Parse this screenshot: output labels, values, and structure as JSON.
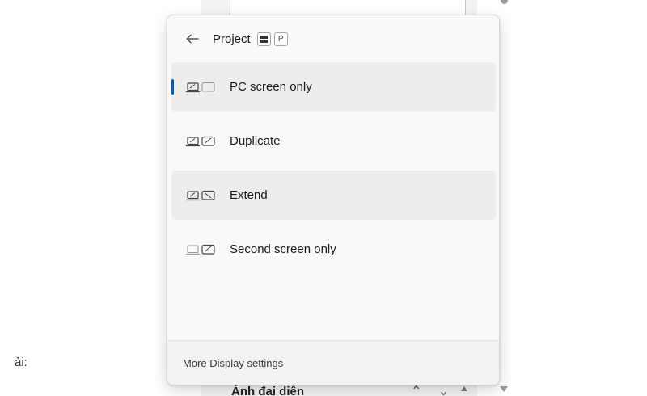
{
  "background": {
    "left_label": "ải:",
    "field_label": "Ảnh đại diện",
    "chevrons": "⌃ ⌄"
  },
  "flyout": {
    "title": "Project",
    "shortcut": {
      "key_icon": "windows-logo-icon",
      "key_letter": "P"
    },
    "back_icon": "arrow-left-icon",
    "options": [
      {
        "label": "PC screen only",
        "icon": "pc-screen-only-icon",
        "selected": true,
        "highlighted": true
      },
      {
        "label": "Duplicate",
        "icon": "duplicate-icon",
        "selected": false,
        "highlighted": false
      },
      {
        "label": "Extend",
        "icon": "extend-icon",
        "selected": false,
        "highlighted": true
      },
      {
        "label": "Second screen only",
        "icon": "second-screen-only-icon",
        "selected": false,
        "highlighted": false
      }
    ],
    "footer_link": "More Display settings"
  },
  "colors": {
    "accent": "#005fb8",
    "flyout_bg": "#f9f9f9",
    "highlight_bg": "#ededed"
  }
}
